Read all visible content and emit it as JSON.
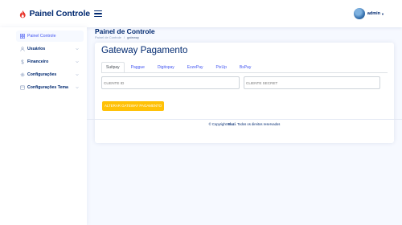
{
  "header": {
    "logo_text": "Painel Controle",
    "user_name": "admin",
    "icons": [
      "flame-logo-icon",
      "hamburger-menu-icon",
      "avatar",
      "caret-down-icon"
    ]
  },
  "sidebar": {
    "items": [
      {
        "label": "Painel Controle",
        "icon": "grid-icon",
        "active": true,
        "has_chevron": false
      },
      {
        "label": "Usuários",
        "icon": "person-icon",
        "active": false,
        "has_chevron": true
      },
      {
        "label": "Financeiro",
        "icon": "dollar-icon",
        "active": false,
        "has_chevron": true
      },
      {
        "label": "Configurações",
        "icon": "gear-icon",
        "active": false,
        "has_chevron": true
      },
      {
        "label": "Configurações Tema",
        "icon": "window-icon",
        "active": false,
        "has_chevron": true
      }
    ]
  },
  "page": {
    "title": "Painel de Controle",
    "breadcrumb": [
      "Painel de Controle",
      "gateway"
    ]
  },
  "card": {
    "title": "Gateway Pagamento",
    "tabs": [
      "Suitpay",
      "Paggue",
      "Digitopay",
      "EzzePay",
      "PixUp",
      "BsPay"
    ],
    "active_tab": "Suitpay",
    "client_id_placeholder": "CLIENTE ID",
    "client_id_value": "",
    "client_secret_placeholder": "CLIENTE SECRET",
    "client_secret_value": "",
    "submit_label": "ALTERAR GATEWAY PAGAMENTO"
  },
  "footer": {
    "prefix": "© Copyright",
    "brand": "Blazi",
    "suffix": ". Todos os direitos reservados"
  },
  "colors": {
    "primary": "#4154f1",
    "navy": "#012970",
    "background": "#f6f9ff",
    "button": "#ffc107",
    "logo_red": "#e8382e"
  }
}
